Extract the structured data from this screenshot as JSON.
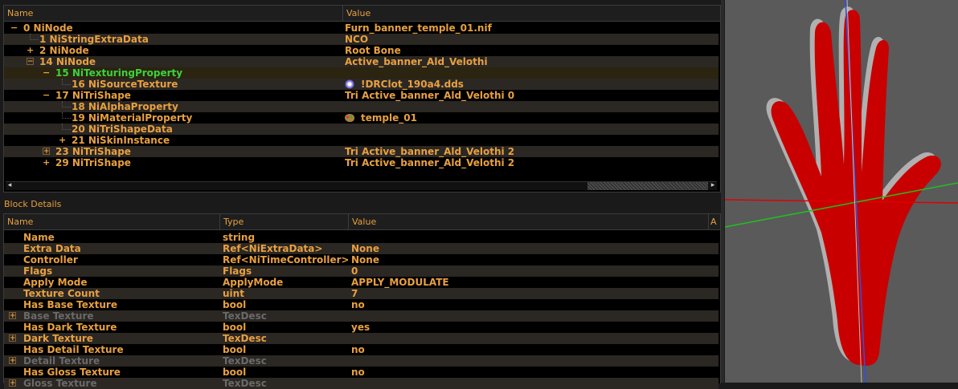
{
  "tree": {
    "headers": {
      "name": "Name",
      "value": "Value"
    },
    "rows": [
      {
        "name": "0 NiNode",
        "value": "Furn_banner_temple_01.nif",
        "depth": 0,
        "expander": "−"
      },
      {
        "name": "1 NiStringExtraData",
        "value": "NCO",
        "depth": 1,
        "expander": ""
      },
      {
        "name": "2 NiNode",
        "value": "Root Bone",
        "depth": 1,
        "expander": "+"
      },
      {
        "name": "14 NiNode",
        "value": "Active_banner_Ald_Velothi",
        "depth": 1,
        "expander": "⊟"
      },
      {
        "name": "15 NiTexturingProperty",
        "value": "",
        "depth": 2,
        "expander": "−",
        "selected": true
      },
      {
        "name": "16 NiSourceTexture",
        "value": "!DRClot_190a4.dds",
        "depth": 3,
        "expander": "",
        "icon": "gear"
      },
      {
        "name": "17 NiTriShape",
        "value": "Tri Active_banner_Ald_Velothi 0",
        "depth": 2,
        "expander": "−"
      },
      {
        "name": "18 NiAlphaProperty",
        "value": "",
        "depth": 3,
        "expander": ""
      },
      {
        "name": "19 NiMaterialProperty",
        "value": "temple_01",
        "depth": 3,
        "expander": "",
        "icon": "palette"
      },
      {
        "name": "20 NiTriShapeData",
        "value": "",
        "depth": 3,
        "expander": ""
      },
      {
        "name": "21 NiSkinInstance",
        "value": "",
        "depth": 3,
        "expander": "+"
      },
      {
        "name": "23 NiTriShape",
        "value": "Tri Active_banner_Ald_Velothi 2",
        "depth": 2,
        "expander": "⊞"
      },
      {
        "name": "29 NiTriShape",
        "value": "Tri Active_banner_Ald_Velothi 2",
        "depth": 2,
        "expander": "+"
      }
    ]
  },
  "details": {
    "title": "Block Details",
    "headers": {
      "name": "Name",
      "type": "Type",
      "value": "Value",
      "extra": "A"
    },
    "rows": [
      {
        "name": "Name",
        "type": "string",
        "value": ""
      },
      {
        "name": "Extra Data",
        "type": "Ref<NiExtraData>",
        "value": "None"
      },
      {
        "name": "Controller",
        "type": "Ref<NiTimeController>",
        "value": "None"
      },
      {
        "name": "Flags",
        "type": "Flags",
        "value": "0"
      },
      {
        "name": "Apply Mode",
        "type": "ApplyMode",
        "value": "APPLY_MODULATE"
      },
      {
        "name": "Texture Count",
        "type": "uint",
        "value": "7"
      },
      {
        "name": "Has Base Texture",
        "type": "bool",
        "value": "no"
      },
      {
        "name": "Base Texture",
        "type": "TexDesc",
        "value": "",
        "expander": "⊞",
        "dim": true
      },
      {
        "name": "Has Dark Texture",
        "type": "bool",
        "value": "yes"
      },
      {
        "name": "Dark Texture",
        "type": "TexDesc",
        "value": "",
        "expander": "⊞"
      },
      {
        "name": "Has Detail Texture",
        "type": "bool",
        "value": "no"
      },
      {
        "name": "Detail Texture",
        "type": "TexDesc",
        "value": "",
        "expander": "⊞",
        "dim": true
      },
      {
        "name": "Has Gloss Texture",
        "type": "bool",
        "value": "no"
      },
      {
        "name": "Gloss Texture",
        "type": "TexDesc",
        "value": "",
        "expander": "⊞",
        "dim": true
      }
    ]
  },
  "scroll_arrows": {
    "left": "◂",
    "right": "▸"
  },
  "colors": {
    "accent": "#e8a040",
    "selected": "#3cd23c",
    "mesh": "#c80000"
  },
  "viewport": {
    "axes": [
      "x-axis-red",
      "y-axis-green",
      "z-axis-blue"
    ]
  }
}
